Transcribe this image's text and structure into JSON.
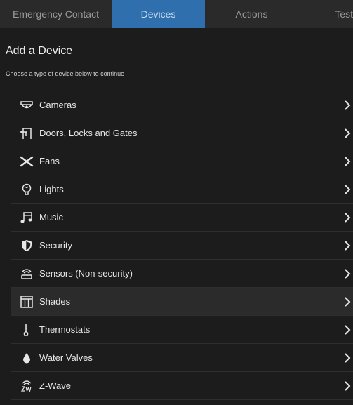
{
  "tabs": [
    {
      "label": "Emergency Contact",
      "active": false
    },
    {
      "label": "Devices",
      "active": true
    },
    {
      "label": "Actions",
      "active": false
    },
    {
      "label": "Test",
      "active": false
    }
  ],
  "header": {
    "title": "Add a Device",
    "subtitle": "Choose a type of device below to continue"
  },
  "devices": [
    {
      "label": "Cameras",
      "icon": "camera-icon"
    },
    {
      "label": "Doors, Locks and Gates",
      "icon": "door-lock-icon"
    },
    {
      "label": "Fans",
      "icon": "fan-icon"
    },
    {
      "label": "Lights",
      "icon": "lightbulb-icon"
    },
    {
      "label": "Music",
      "icon": "music-note-icon"
    },
    {
      "label": "Security",
      "icon": "shield-icon"
    },
    {
      "label": "Sensors (Non-security)",
      "icon": "sensor-icon"
    },
    {
      "label": "Shades",
      "icon": "shades-icon",
      "selected": true
    },
    {
      "label": "Thermostats",
      "icon": "thermometer-icon"
    },
    {
      "label": "Water Valves",
      "icon": "water-drop-icon"
    },
    {
      "label": "Z-Wave",
      "icon": "zwave-icon"
    }
  ],
  "colors": {
    "accent": "#2f6fae",
    "background": "#1c1c1c",
    "tabbar": "#2a2a2a",
    "highlight_row": "#2b2b2b"
  }
}
